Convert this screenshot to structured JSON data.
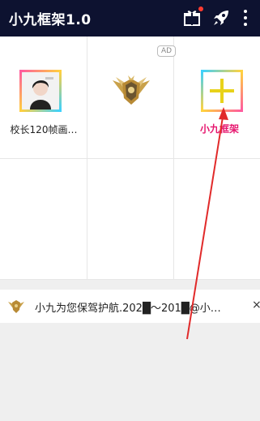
{
  "appbar": {
    "title": "小九框架1.0",
    "gift_icon": "gift-icon",
    "rocket_icon": "rocket-icon",
    "more_icon": "more-vertical-icon",
    "gift_badge_color": "#ff3b30"
  },
  "grid": {
    "ad_badge": "AD",
    "apps": [
      {
        "label": "校长120帧画…",
        "icon": "avatar-image"
      },
      {
        "label": "小九框架",
        "icon": "winged-emblem-icon"
      },
      {
        "label": "",
        "icon": "plus-icon"
      }
    ]
  },
  "notice": {
    "icon": "emblem-icon",
    "text": "小九为您保驾护航.202█～201█@小…",
    "close": "×"
  },
  "colors": {
    "appbar": "#0d1230",
    "accent_label": "#e6166e",
    "arrow": "#e12a2a"
  }
}
